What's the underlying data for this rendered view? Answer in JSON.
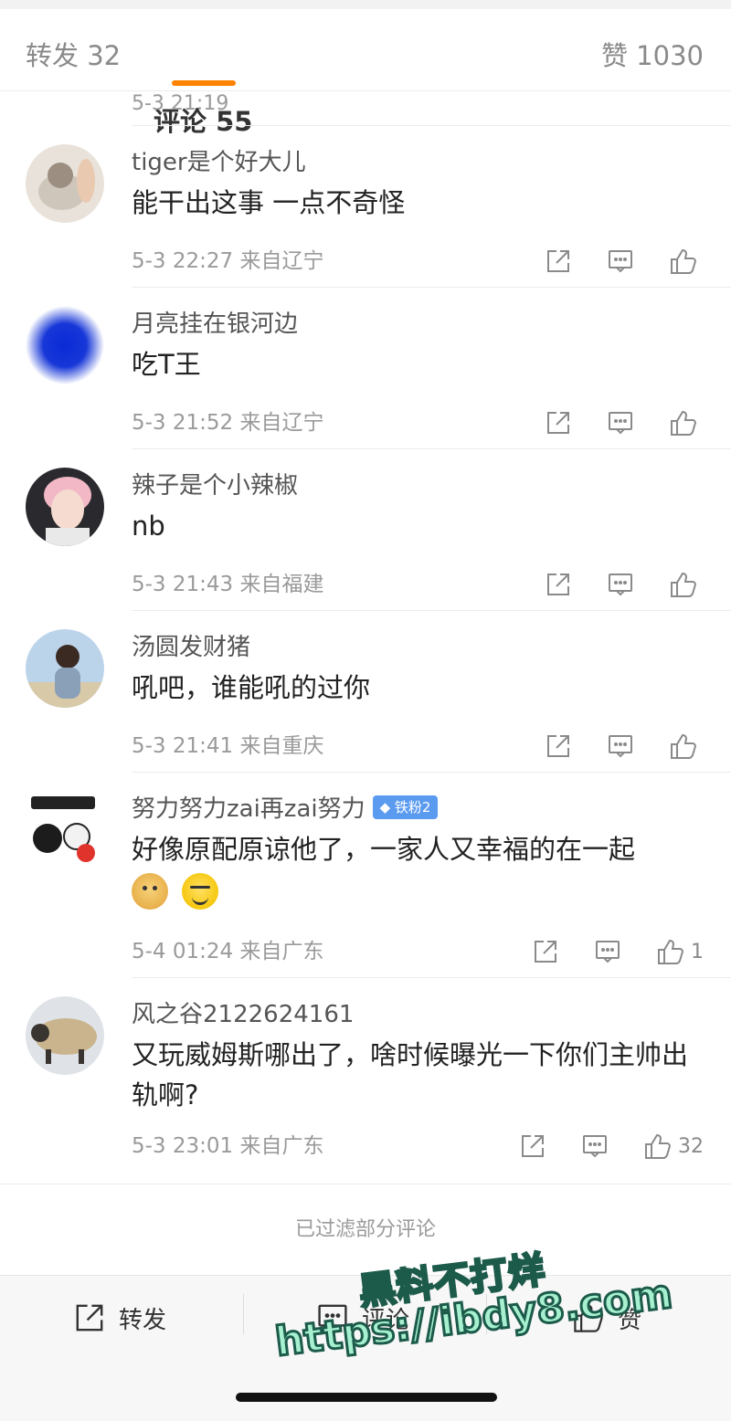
{
  "tabs": {
    "repost": "转发 32",
    "comments": "评论 55",
    "likes": "赞 1030"
  },
  "partial": {
    "meta": "5-3 21:19"
  },
  "comments": [
    {
      "user": "tiger是个好大儿",
      "text": "能干出这事 一点不奇怪",
      "meta": "5-3 22:27 来自辽宁",
      "likes": ""
    },
    {
      "user": "月亮挂在银河边",
      "text": "吃T王",
      "meta": "5-3 21:52 来自辽宁",
      "likes": ""
    },
    {
      "user": "辣子是个小辣椒",
      "text": "nb",
      "meta": "5-3 21:43 来自福建",
      "likes": ""
    },
    {
      "user": "汤圆发财猪",
      "text": "吼吧，谁能吼的过你",
      "meta": "5-3 21:41 来自重庆",
      "likes": ""
    },
    {
      "user": "努力努力zai再zai努力",
      "badge": "铁粉2",
      "text": "好像原配原谅他了，一家人又幸福的在一起",
      "meta": "5-4 01:24 来自广东",
      "likes": "1"
    },
    {
      "user": "风之谷2122624161",
      "text": "又玩威姆斯哪出了，啥时候曝光一下你们主帅出轨啊?",
      "meta": "5-3 23:01 来自广东",
      "likes": "32"
    }
  ],
  "filtered_notice": "已过滤部分评论",
  "bottombar": {
    "repost": "转发",
    "comment": "评论",
    "like": "赞"
  },
  "watermark": {
    "line1": "黑料不打烊",
    "line2": "https://ibdy8.com"
  },
  "colors": {
    "accent": "#ff8200",
    "badge": "#5b9bef"
  }
}
